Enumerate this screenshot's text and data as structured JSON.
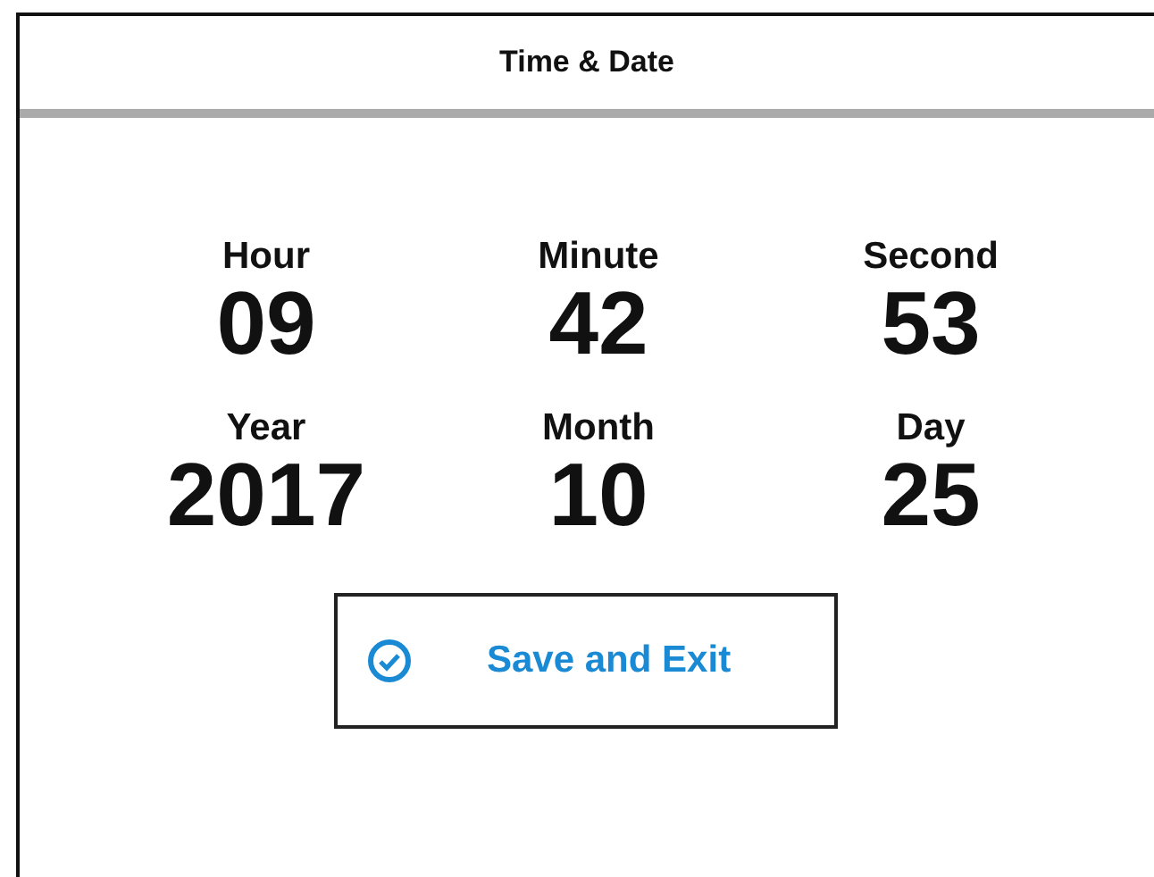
{
  "window": {
    "title": "Time & Date"
  },
  "fields": [
    {
      "label": "Hour",
      "value": "09"
    },
    {
      "label": "Minute",
      "value": "42"
    },
    {
      "label": "Second",
      "value": "53"
    },
    {
      "label": "Year",
      "value": "2017"
    },
    {
      "label": "Month",
      "value": "10"
    },
    {
      "label": "Day",
      "value": "25"
    }
  ],
  "buttons": [
    {
      "label": "Save and Exit"
    }
  ]
}
